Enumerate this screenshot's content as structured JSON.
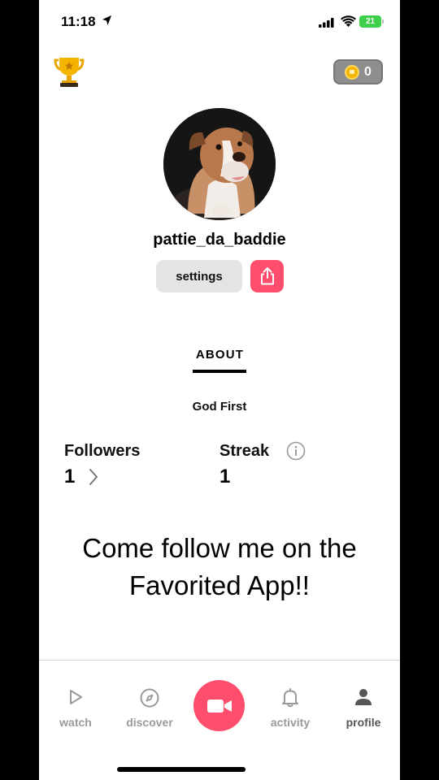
{
  "status": {
    "time": "11:18",
    "battery": "21"
  },
  "header": {
    "coins": "0"
  },
  "profile": {
    "username": "pattie_da_baddie",
    "settings_label": "settings",
    "about_label": "ABOUT",
    "bio": "God First",
    "followers_label": "Followers",
    "followers_count": "1",
    "streak_label": "Streak",
    "streak_count": "1"
  },
  "promo": {
    "line1": "Come follow me on the",
    "line2": "Favorited App!!"
  },
  "tabs": [
    {
      "label": "watch",
      "icon": "play-icon"
    },
    {
      "label": "discover",
      "icon": "compass-icon"
    },
    {
      "label": "",
      "icon": "video-camera-icon"
    },
    {
      "label": "activity",
      "icon": "bell-icon"
    },
    {
      "label": "profile",
      "icon": "person-icon"
    }
  ],
  "colors": {
    "accent": "#ff4d6d",
    "battery": "#3ecf4a",
    "coin": "#f5b400"
  }
}
